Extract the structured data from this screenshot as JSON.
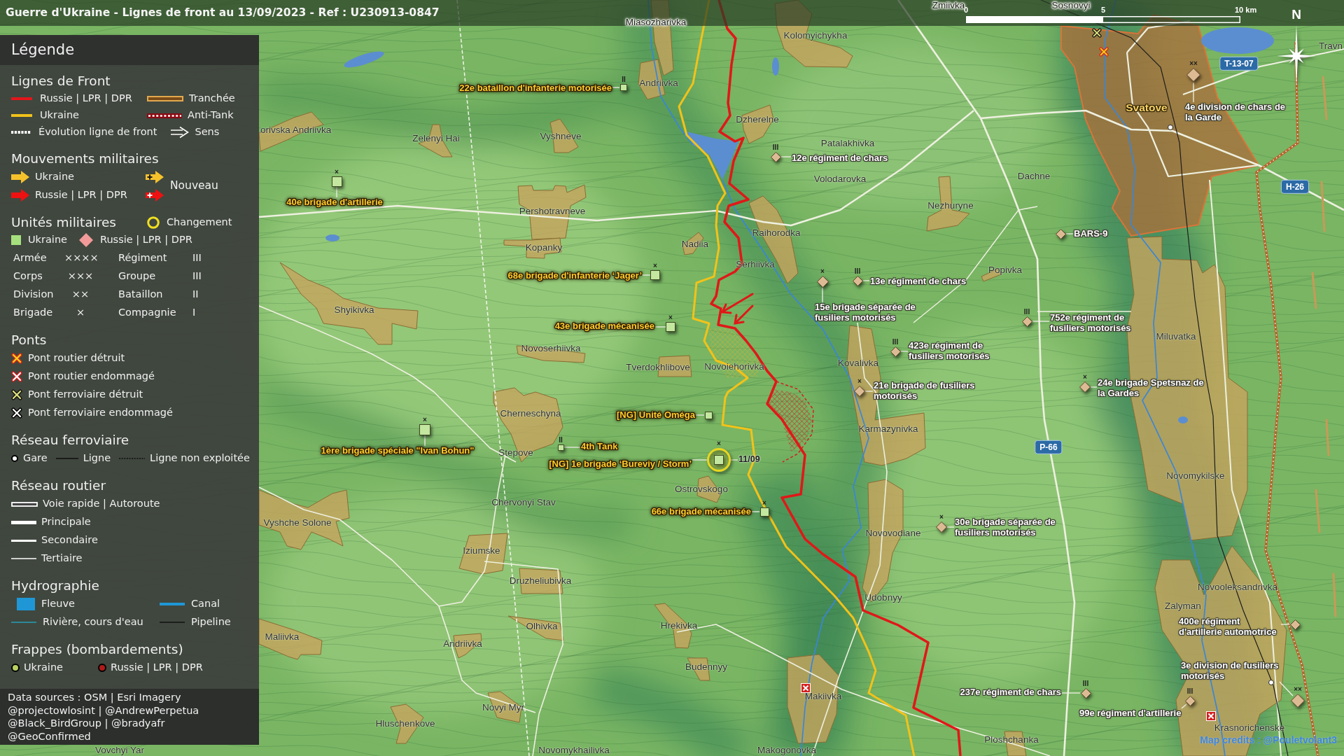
{
  "title_bar": {
    "title": "Guerre d'Ukraine - Lignes de front au 13/09/2023 - Ref : U230913-0847"
  },
  "scale_bar": {
    "labels": [
      "0",
      "5",
      "10 km"
    ]
  },
  "compass": {
    "label": "N"
  },
  "legend": {
    "title": "Légende",
    "sections": [
      {
        "kind": "front-lines",
        "title": "Lignes de Front",
        "items": [
          {
            "kind": "russia-line",
            "label": "Russie | LPR | DPR"
          },
          {
            "kind": "trench",
            "label": "Tranchée"
          },
          {
            "kind": "ukraine-line",
            "label": "Ukraine"
          },
          {
            "kind": "anti-tank",
            "label": "Anti-Tank"
          },
          {
            "kind": "evolution",
            "label": "Évolution ligne de front"
          },
          {
            "kind": "direction",
            "label": "Sens"
          }
        ]
      },
      {
        "kind": "movements",
        "title": "Mouvements militaires",
        "items": [
          {
            "kind": "ukraine-arrow",
            "label": "Ukraine"
          },
          {
            "kind": "russia-arrow",
            "label": "Russie | LPR | DPR"
          }
        ],
        "new_symbols": [
          {
            "kind": "ukraine-arrow"
          },
          {
            "kind": "russia-arrow"
          }
        ],
        "new_label": "Nouveau"
      },
      {
        "kind": "units",
        "title": "Unités militaires",
        "change_label": "Changement",
        "items": [
          {
            "kind": "ukraine-unit",
            "label": "Ukraine"
          },
          {
            "kind": "russia-unit",
            "label": "Russie | LPR | DPR"
          }
        ],
        "echelons": [
          {
            "label": "Armée",
            "symbol": "××××"
          },
          {
            "label": "Régiment",
            "symbol": "III"
          },
          {
            "label": "Corps",
            "symbol": "×××"
          },
          {
            "label": "Groupe",
            "symbol": "III"
          },
          {
            "label": "Division",
            "symbol": "××"
          },
          {
            "label": "Bataillon",
            "symbol": "II"
          },
          {
            "label": "Brigade",
            "symbol": "×"
          },
          {
            "label": "Compagnie",
            "symbol": "I"
          }
        ]
      },
      {
        "kind": "bridges",
        "title": "Ponts",
        "items": [
          {
            "kind": "road-destroyed",
            "label": "Pont routier détruit"
          },
          {
            "kind": "road-damaged",
            "label": "Pont routier endommagé"
          },
          {
            "kind": "rail-destroyed",
            "label": "Pont ferroviaire détruit"
          },
          {
            "kind": "rail-damaged",
            "label": "Pont ferroviaire endommagé"
          }
        ]
      },
      {
        "kind": "railway",
        "title": "Réseau ferroviaire",
        "items": [
          {
            "kind": "station",
            "label": "Gare"
          },
          {
            "kind": "rail-line",
            "label": "Ligne"
          },
          {
            "kind": "unused-rail-line",
            "label": "Ligne non exploitée"
          }
        ]
      },
      {
        "kind": "roads",
        "title": "Réseau routier",
        "items": [
          {
            "kind": "highway",
            "label": "Voie rapide | Autoroute"
          },
          {
            "kind": "primary-road",
            "label": "Principale"
          },
          {
            "kind": "secondary-road",
            "label": "Secondaire"
          },
          {
            "kind": "tertiary-road",
            "label": "Tertiaire"
          }
        ]
      },
      {
        "kind": "hydrography",
        "title": "Hydrographie",
        "items": [
          {
            "kind": "river",
            "label": "Fleuve"
          },
          {
            "kind": "canal",
            "label": "Canal"
          },
          {
            "kind": "stream",
            "label": "Rivière, cours d'eau"
          },
          {
            "kind": "pipeline",
            "label": "Pipeline"
          }
        ]
      },
      {
        "kind": "strikes",
        "title": "Frappes (bombardements)",
        "items": [
          {
            "kind": "ukraine-strike",
            "label": "Ukraine"
          },
          {
            "kind": "russia-strike",
            "label": "Russie | LPR | DPR"
          }
        ]
      }
    ],
    "sources": [
      "Data sources : OSM | Esri Imagery",
      "@projectowlosint | @AndrewPerpetua",
      "@Black_BirdGroup | @bradyafr",
      "@GeoConfirmed"
    ]
  },
  "map": {
    "places": [
      {
        "kind": "town",
        "name": "Zmiivka"
      },
      {
        "kind": "town",
        "name": "Sosnovyi"
      },
      {
        "kind": "town",
        "name": "Miasozharivka"
      },
      {
        "kind": "town",
        "name": "Kolomyichykha"
      },
      {
        "kind": "town",
        "name": "Travn"
      },
      {
        "kind": "town",
        "name": "Andriivka"
      },
      {
        "kind": "city",
        "name": "Svatove"
      },
      {
        "kind": "town",
        "name": "Dzherelne"
      },
      {
        "kind": "town",
        "name": "orivska Andriivka"
      },
      {
        "kind": "town",
        "name": "Zelenyi Hai"
      },
      {
        "kind": "town",
        "name": "Vyshneve"
      },
      {
        "kind": "town",
        "name": "Patalakhivka"
      },
      {
        "kind": "town",
        "name": "Volodarovka"
      },
      {
        "kind": "town",
        "name": "Dachne"
      },
      {
        "kind": "town",
        "name": "Pershotravneve"
      },
      {
        "kind": "town",
        "name": "Nezhuryne"
      },
      {
        "kind": "town",
        "name": "Raihorodka"
      },
      {
        "kind": "town",
        "name": "Kopanky"
      },
      {
        "kind": "town",
        "name": "Nadiia"
      },
      {
        "kind": "town",
        "name": "Serhiivka"
      },
      {
        "kind": "town",
        "name": "Popivka"
      },
      {
        "kind": "town",
        "name": "Shyikivka"
      },
      {
        "kind": "town",
        "name": "Miluvatka"
      },
      {
        "kind": "town",
        "name": "Novoserhiivka"
      },
      {
        "kind": "town",
        "name": "Tverdokhlibove"
      },
      {
        "kind": "town",
        "name": "Novoiehorivka"
      },
      {
        "kind": "town",
        "name": "Kovalivka"
      },
      {
        "kind": "town",
        "name": "Cherneschyna"
      },
      {
        "kind": "town",
        "name": "Karmazynivka"
      },
      {
        "kind": "town",
        "name": "Stepove"
      },
      {
        "kind": "town",
        "name": "Novomykilske"
      },
      {
        "kind": "town",
        "name": "Ostrovskogo"
      },
      {
        "kind": "town",
        "name": "Chervonyi Stav"
      },
      {
        "kind": "town",
        "name": "Vyshche Solone"
      },
      {
        "kind": "town",
        "name": "Novovodiane"
      },
      {
        "kind": "town",
        "name": "Iziumske"
      },
      {
        "kind": "town",
        "name": "Druzheliubivka"
      },
      {
        "kind": "town",
        "name": "Novooleksandrivka"
      },
      {
        "kind": "town",
        "name": "Udobnyy"
      },
      {
        "kind": "town",
        "name": "Zalyman"
      },
      {
        "kind": "town",
        "name": "Olhivka"
      },
      {
        "kind": "town",
        "name": "Hrekivka"
      },
      {
        "kind": "town",
        "name": "Maliivka"
      },
      {
        "kind": "town",
        "name": "Andriivka"
      },
      {
        "kind": "town",
        "name": "Budennyy"
      },
      {
        "kind": "town",
        "name": "Makiivka"
      },
      {
        "kind": "town",
        "name": "Novyi Myr"
      },
      {
        "kind": "town",
        "name": "Hluschenkove"
      },
      {
        "kind": "town",
        "name": "Krasnorichenske"
      },
      {
        "kind": "town",
        "name": "Ploshchanka"
      },
      {
        "kind": "town",
        "name": "Vovchyi Yar"
      },
      {
        "kind": "town",
        "name": "Novomykhailivka"
      },
      {
        "kind": "town",
        "name": "Makogonovka"
      }
    ],
    "units": [
      {
        "kind": "russia",
        "label": "4e division de chars de la Garde",
        "echelon": "××",
        "changed": false
      },
      {
        "kind": "ukraine",
        "label": "22e bataillon d'infanterie motorisée",
        "echelon": "II",
        "changed": false
      },
      {
        "kind": "russia",
        "label": "12e régiment de chars",
        "echelon": "III",
        "changed": false
      },
      {
        "kind": "ukraine",
        "label": "40e brigade d'artillerie",
        "echelon": "×",
        "changed": false
      },
      {
        "kind": "russia",
        "label": "BARS-9",
        "changed": false
      },
      {
        "kind": "ukraine",
        "label": "68e brigade d'infanterie ‘Jager’",
        "echelon": "×",
        "changed": false
      },
      {
        "kind": "russia",
        "label": "15e brigade séparée de fusiliers motorisés",
        "echelon": "×",
        "changed": false
      },
      {
        "kind": "russia",
        "label": "13e régiment de chars",
        "echelon": "III",
        "changed": false
      },
      {
        "kind": "ukraine",
        "label": "43e brigade mécanisée",
        "echelon": "×",
        "changed": false
      },
      {
        "kind": "russia",
        "label": "752e régiment de fusiliers motorisés",
        "echelon": "III",
        "changed": false
      },
      {
        "kind": "russia",
        "label": "423e régiment de fusiliers motorisés",
        "echelon": "III",
        "changed": false
      },
      {
        "kind": "russia",
        "label": "21e brigade de fusiliers motorisés",
        "echelon": "×",
        "changed": false
      },
      {
        "kind": "russia",
        "label": "24e brigade Spetsnaz de la Gardes",
        "echelon": "×",
        "changed": false
      },
      {
        "kind": "ukraine",
        "label": "[NG] Unité Oméga",
        "changed": false
      },
      {
        "kind": "ukraine",
        "label": "1ère brigade spéciale \"Ivan Bohun\"",
        "echelon": "×",
        "changed": false
      },
      {
        "kind": "ukraine",
        "label": "4th Tank",
        "echelon": "II",
        "changed": false
      },
      {
        "kind": "ukraine",
        "label": "[NG] 1e brigade ‘Bureviy / Storm’",
        "echelon": "×",
        "changed": true,
        "date": "11/09"
      },
      {
        "kind": "ukraine",
        "label": "66e brigade mécanisée",
        "echelon": "×",
        "changed": false
      },
      {
        "kind": "russia",
        "label": "30e brigade séparée de fusiliers motorisés",
        "echelon": "×",
        "changed": false
      },
      {
        "kind": "russia",
        "label": "400e régiment d'artillerie automotrice",
        "changed": false
      },
      {
        "kind": "russia",
        "label": "3e division de fusiliers motorisés",
        "echelon": "××",
        "changed": false
      },
      {
        "kind": "russia",
        "label": "237e régiment de chars",
        "echelon": "III",
        "changed": false
      },
      {
        "kind": "russia",
        "label": "99e régiment d'artillerie",
        "echelon": "III",
        "changed": false
      }
    ],
    "road_numbers": [
      {
        "label": "T-13-07"
      },
      {
        "label": "H-26"
      },
      {
        "label": "P-66"
      }
    ],
    "bridges": [
      {
        "kind": "rail-destroyed"
      },
      {
        "kind": "road-destroyed"
      },
      {
        "kind": "road-damaged"
      },
      {
        "kind": "road-damaged"
      }
    ],
    "credits": "Map credits : @Pouletvolant3"
  }
}
